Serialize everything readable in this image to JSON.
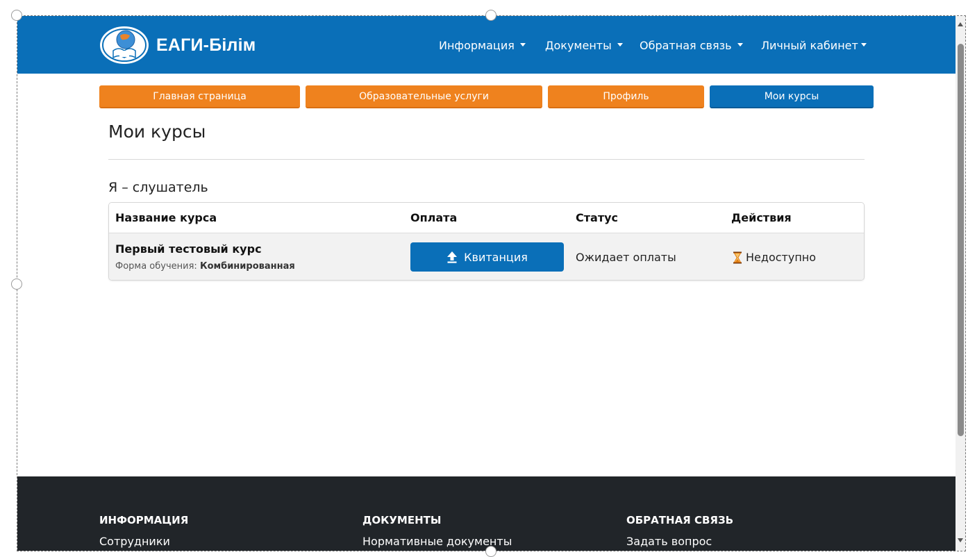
{
  "header": {
    "brand": "ЕАГИ-Білім",
    "nav": [
      {
        "label": "Информация"
      },
      {
        "label": "Документы"
      },
      {
        "label": "Обратная связь"
      },
      {
        "label": "Личный кабинет"
      }
    ]
  },
  "tabs": [
    {
      "label": "Главная страница",
      "active": false
    },
    {
      "label": "Образовательные услуги",
      "active": false
    },
    {
      "label": "Профиль",
      "active": false
    },
    {
      "label": "Мои курсы",
      "active": true
    }
  ],
  "main": {
    "title": "Мои курсы",
    "section_title": "Я – слушатель",
    "table": {
      "columns": [
        "Название курса",
        "Оплата",
        "Статус",
        "Действия"
      ],
      "rows": [
        {
          "course_name": "Первый тестовый курс",
          "form_label": "Форма обучения:",
          "form_value": "Комбинированная",
          "payment_button": "Квитанция",
          "status": "Ожидает оплаты",
          "action": "Недоступно"
        }
      ]
    }
  },
  "footer": {
    "columns": [
      {
        "heading": "ИНФОРМАЦИЯ",
        "link": "Сотрудники"
      },
      {
        "heading": "ДОКУМЕНТЫ",
        "link": "Нормативные документы"
      },
      {
        "heading": "ОБРАТНАЯ СВЯЗЬ",
        "link": "Задать вопрос"
      }
    ]
  },
  "icons": {
    "upload": "upload-arrow-icon",
    "action": "hourglass-icon",
    "logo": "institute-emblem-logo"
  },
  "colors": {
    "primary_blue": "#0a6fb8",
    "tab_orange": "#ef821e",
    "footer_dark": "#212529",
    "row_bg": "#f2f2f2",
    "hourglass": "#e07a10"
  }
}
